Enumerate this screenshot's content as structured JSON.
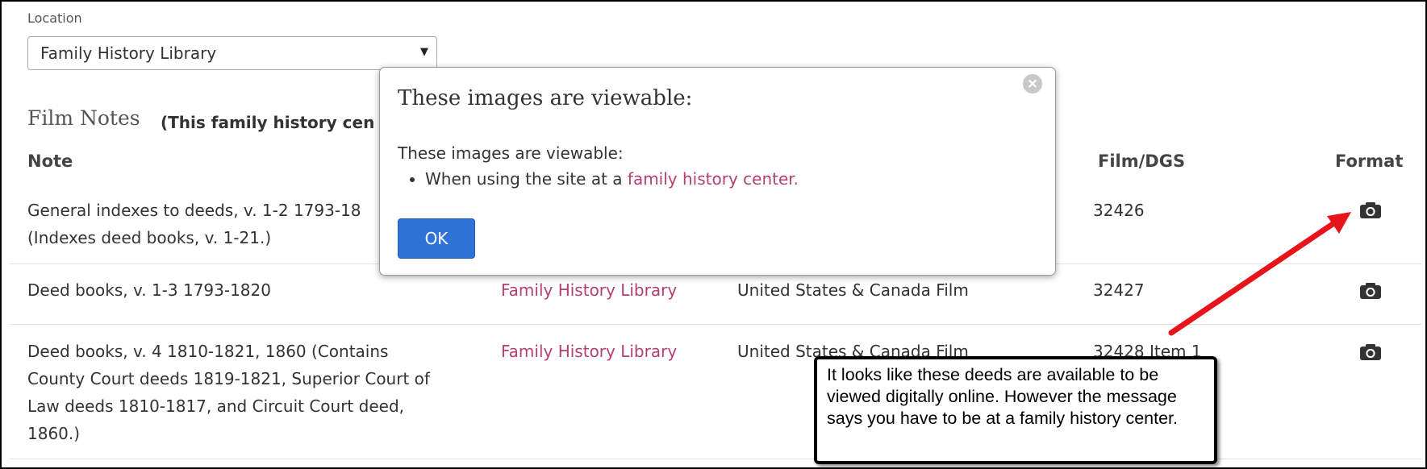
{
  "location": {
    "label": "Location",
    "selected": "Family History Library"
  },
  "film_notes": {
    "title": "Film Notes",
    "note": "(This family history cen"
  },
  "table": {
    "headers": {
      "note": "Note",
      "film": "Film/DGS",
      "format": "Format"
    },
    "rows": [
      {
        "note": "General indexes to deeds, v. 1-2 1793-18",
        "note2": "(Indexes deed books, v. 1-21.)",
        "film": "32426",
        "format_icon": "camera-icon"
      },
      {
        "note": "Deed books, v. 1-3 1793-1820",
        "location": "Family History Library",
        "collection": "United States & Canada Film",
        "film": "32427",
        "format_icon": "camera-icon"
      },
      {
        "note_lines": [
          "Deed books, v. 4 1810-1821, 1860 (Contains",
          "County Court deeds 1819-1821, Superior Court of",
          "Law deeds 1810-1817, and Circuit Court deed,",
          "1860.)"
        ],
        "location": "Family History Library",
        "collection": "United States & Canada Film",
        "film": "32428 Item 1",
        "format_icon": "camera-icon"
      }
    ]
  },
  "modal": {
    "title": "These images are viewable:",
    "body_text": "These images are viewable:",
    "bullet_prefix": "When using the site at a ",
    "bullet_link": "family history center.",
    "ok_label": "OK",
    "close_icon": "close-icon"
  },
  "callout": {
    "text": "It looks like these deeds are available to be viewed digitally online. However the message says you have to be at a family history center."
  },
  "colors": {
    "link": "#b3406e",
    "ok_button": "#2f73d9",
    "arrow": "#e8141b"
  }
}
